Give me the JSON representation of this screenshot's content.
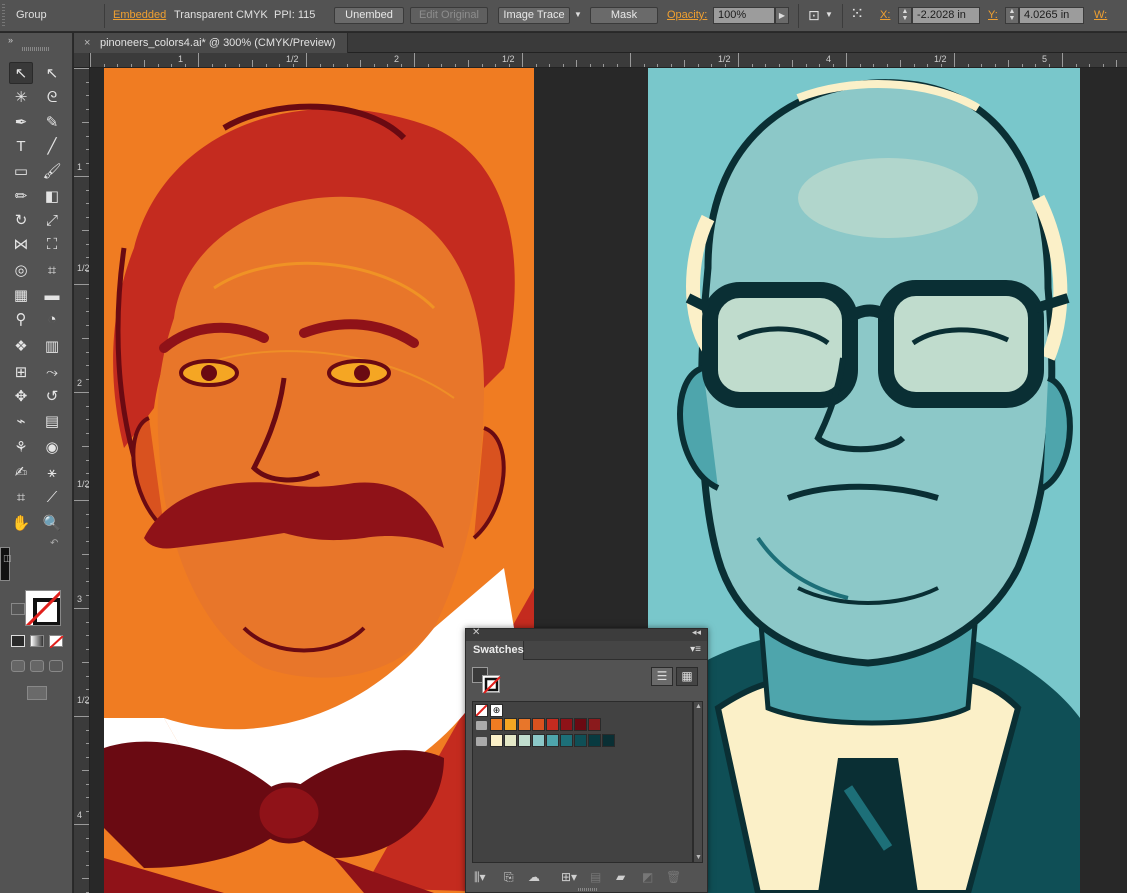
{
  "control_bar": {
    "selection_type": "Group",
    "embedded_link": "Embedded",
    "color_mode": "Transparent CMYK",
    "ppi": "PPI: 115",
    "unembed_label": "Unembed",
    "edit_original_label": "Edit Original",
    "image_trace_label": "Image Trace",
    "mask_label": "Mask",
    "opacity_label": "Opacity:",
    "opacity_value": "100%",
    "x_label": "X:",
    "x_value": "-2.2028 in",
    "y_label": "Y:",
    "y_value": "4.0265 in",
    "w_label": "W:"
  },
  "document": {
    "tab_title": "pinoneers_colors4.ai* @ 300% (CMYK/Preview)",
    "close_glyph": "×"
  },
  "rulers": {
    "horizontal": [
      "1",
      "1/2",
      "2",
      "1/2",
      "1/2",
      "4",
      "1/2",
      "5"
    ],
    "vertical": [
      "1",
      "1/2",
      "2",
      "1/2",
      "3",
      "1/2",
      "4"
    ]
  },
  "swatches_panel": {
    "title": "Swatches",
    "row_orange": [
      "#f07c22",
      "#f5a623",
      "#e8762a",
      "#d9521f",
      "#c42b1f",
      "#8f1218",
      "#6a0a12",
      "#8a1a1c"
    ],
    "row_teal": [
      "#fbf0c8",
      "#e4e8c7",
      "#c0dccd",
      "#8cc8c8",
      "#4ea5ac",
      "#1d6f78",
      "#0f4f56",
      "#083a40",
      "#0a2f34"
    ]
  },
  "colors": {
    "orange_bg": "#f07c22",
    "teal_bg": "#79c7cb",
    "dark_red": "#6a0a12",
    "dark_teal": "#0a2f34",
    "cream": "#fbf0c8"
  }
}
